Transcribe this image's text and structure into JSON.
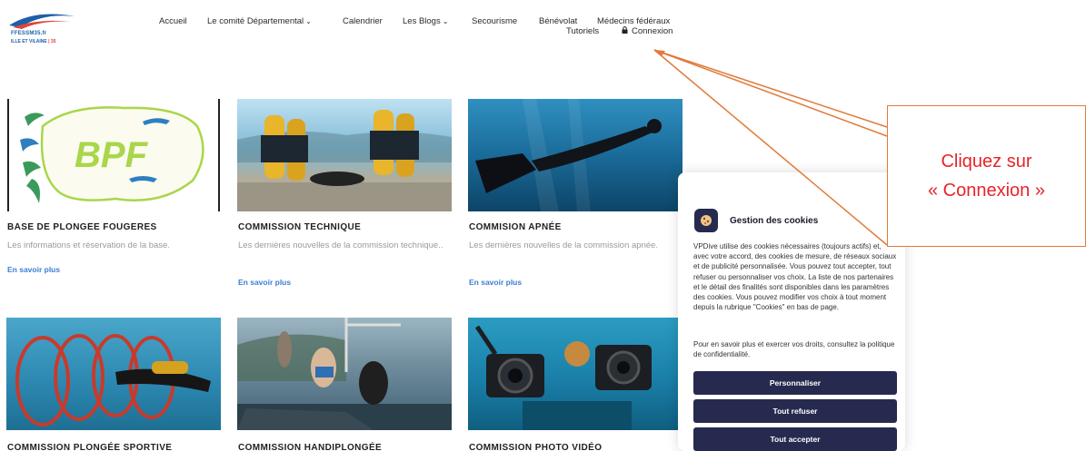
{
  "header": {
    "logo": {
      "brand": "FFESSM35.fr",
      "region": "ILLE ET VILAINE",
      "region_num": "| 35"
    },
    "nav": [
      {
        "label": "Accueil",
        "dropdown": false
      },
      {
        "label": "Le comité Départemental",
        "dropdown": true
      },
      {
        "label": "Calendrier",
        "dropdown": false
      },
      {
        "label": "Les Blogs",
        "dropdown": true
      },
      {
        "label": "Secourisme",
        "dropdown": false
      },
      {
        "label": "Bénévolat",
        "dropdown": false
      },
      {
        "label": "Médecins fédéraux",
        "dropdown": false
      },
      {
        "label": "Tutoriels",
        "dropdown": false
      },
      {
        "label": "Connexion",
        "dropdown": false,
        "icon": "lock-icon"
      }
    ]
  },
  "cards": [
    {
      "title": "BASE DE PLONGEE FOUGERES",
      "desc": "Les informations et réservation de la base.",
      "more": "En savoir plus",
      "logo_text": "BPF"
    },
    {
      "title": "COMMISSION TECHNIQUE",
      "desc": "Les dernières nouvelles de la commission technique..",
      "more": "En savoir plus"
    },
    {
      "title": "COMMISION APNÉE",
      "desc": "Les dernières nouvelles de la commission apnée.",
      "more": "En savoir plus"
    },
    {
      "title": "COMMISSION PLONGÉE SPORTIVE"
    },
    {
      "title": "COMMISSION HANDIPLONGÉE"
    },
    {
      "title": "COMMISSION PHOTO VIDÉO"
    }
  ],
  "cookie": {
    "title": "Gestion des cookies",
    "text": "VPDive utilise des cookies nécessaires (toujours actifs) et, avec votre accord, des cookies de mesure, de réseaux sociaux et de publicité personnalisée. Vous pouvez tout accepter, tout refuser ou personnaliser vos choix. La liste de nos partenaires et le détail des finalités sont disponibles dans les paramètres des cookies. Vous pouvez modifier vos choix à tout moment depuis la rubrique \"Cookies\" en bas de page.",
    "text2": "Pour en savoir plus et exercer vos droits, consultez la politique de confidentialité.",
    "buttons": [
      "Personnaliser",
      "Tout refuser",
      "Tout accepter"
    ]
  },
  "annotation": {
    "line1": "Cliquez sur",
    "line2": "« Connexion »"
  },
  "colors": {
    "accent": "#3a7fd4",
    "cookie_dark": "#262a4f",
    "annotation_red": "#e8232a",
    "annotation_border": "#e07b3a"
  }
}
